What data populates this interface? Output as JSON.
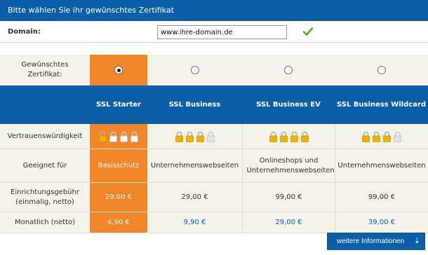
{
  "titlebar": {
    "title": "Bitte wählen Sie ihr gewünschtes Zertifikat"
  },
  "domain": {
    "label": "Domain:",
    "value": "www.ihre-domain.de",
    "placeholder": ""
  },
  "select_row": {
    "label": "Gewünschtes Zertifikat:",
    "selected_index": 0
  },
  "products": [
    {
      "name": "SSL Starter",
      "trust": 1,
      "fit": "Basisschutz",
      "setup": "29,00 €",
      "monthly": "4,90 €"
    },
    {
      "name": "SSL Business",
      "trust": 3,
      "fit": "Unternehmenswebseiten",
      "setup": "29,00 €",
      "monthly": "9,90 €"
    },
    {
      "name": "SSL Business EV",
      "trust": 4,
      "fit": "Onlineshops und Unternehmenswebseiten",
      "setup": "99,00 €",
      "monthly": "29,00 €"
    },
    {
      "name": "SSL Business Wildcard",
      "trust": 3,
      "fit": "Unternehmenswebseiten",
      "setup": "99,00 €",
      "monthly": "39,00 €"
    }
  ],
  "row_labels": {
    "trust": "Vertrauenswürdigkeit",
    "fit": "Geeignet für",
    "setup": "Einrichtungsgebühr (einmalig, netto)",
    "monthly": "Monatlich (netto)"
  },
  "buttons": {
    "more_info": "weitere Informationen"
  },
  "icons": {
    "domain_status": "check-icon",
    "trust": "padlock-icon",
    "more_info": "arrow-down-icon"
  },
  "colors": {
    "brand_blue": "#0a5fa6",
    "highlight_orange": "#f0852a",
    "lock_active": "#f0b400",
    "lock_inactive": "#e2e2e2",
    "check_green": "#4caf20"
  }
}
